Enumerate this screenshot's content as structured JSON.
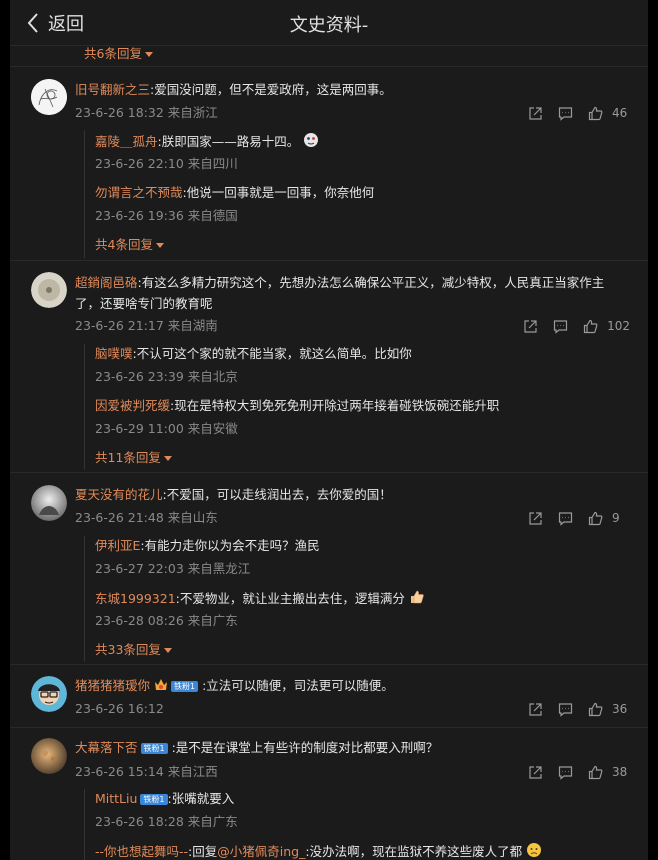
{
  "header": {
    "back_label": "返回",
    "title": "文史资料-"
  },
  "top_more": "共6条回复",
  "comments": [
    {
      "user": "旧号翻新之三",
      "text": ":爱国没问题，但不是爱政府，这是两回事。",
      "meta": "23-6-26 18:32 来自浙江",
      "likes": "46",
      "replies": [
        {
          "user": "嘉陵＿孤舟",
          "text": ":朕即国家——路易十四。",
          "meta": "23-6-26 22:10 来自四川"
        },
        {
          "user": "勿谓言之不预哉",
          "text": ":他说一回事就是一回事，你奈他何",
          "meta": "23-6-26 19:36 来自德国"
        }
      ],
      "more": "共4条回复"
    },
    {
      "user": "超銷阁邑硌",
      "text_line1": ":有这么多精力研究这个，先想办法怎么确保公平正义，减少特权，人民真正当家作主",
      "text_line2": "了，还要啥专门的教育呢",
      "meta": "23-6-26 21:17 来自湖南",
      "likes": "102",
      "replies": [
        {
          "user": "脑噗噗",
          "text": ":不认可这个家的就不能当家，就这么简单。比如你",
          "meta": "23-6-26 23:39 来自北京"
        },
        {
          "user": "因爱被判死缓",
          "text": ":现在是特权大到免死免刑开除过两年接着碰铁饭碗还能升职",
          "meta": "23-6-29 11:00 来自安徽"
        }
      ],
      "more": "共11条回复"
    },
    {
      "user": "夏天没有的花儿",
      "text": ":不爱国，可以走线润出去，去你爱的国！",
      "meta": "23-6-26 21:48 来自山东",
      "likes": "9",
      "replies": [
        {
          "user": "伊利亚E",
          "text": ":有能力走你以为会不走吗？渔民",
          "meta": "23-6-27 22:03 来自黑龙江"
        },
        {
          "user": "东城1999321",
          "text": ":不爱物业，就让业主搬出去住，逻辑满分",
          "meta": "23-6-28 08:26 来自广东"
        }
      ],
      "more": "共33条回复"
    },
    {
      "user": "猪猪猪猪瑷你",
      "badge": "铁粉1",
      "text": ":立法可以随便，司法更可以随便。",
      "meta": "23-6-26 16:12",
      "likes": "36"
    },
    {
      "user": "大幕落下否",
      "badge": "铁粉1",
      "text": ":是不是在课堂上有些许的制度对比都要入刑啊？",
      "meta": "23-6-26 15:14 来自江西",
      "likes": "38",
      "replies": [
        {
          "user": "MittLiu",
          "badge": "铁粉1",
          "text": ":张嘴就要入",
          "meta": "23-6-26 18:28 来自广东"
        },
        {
          "user": "--你也想起舞吗--",
          "text_prefix": ":回复",
          "mention": "@小猪佩奇ing_",
          "text": ":没办法啊，现在监狱不养这些废人了都"
        }
      ]
    }
  ],
  "colors": {
    "background": "#1b1b1b",
    "username": "#e08a5a",
    "meta": "#8a8a8a",
    "badge": "#3a86d8"
  },
  "icons": [
    "chevron-left-icon",
    "share-icon",
    "comment-icon",
    "like-icon"
  ]
}
